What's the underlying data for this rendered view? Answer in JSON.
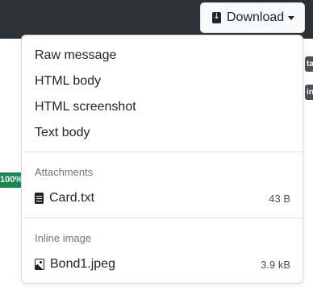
{
  "toolbar": {
    "download_label": "Download"
  },
  "background": {
    "percent_badge": "100%",
    "edge_tab_1": "ta",
    "edge_tab_2": "in"
  },
  "menu": {
    "items": [
      {
        "label": "Raw message"
      },
      {
        "label": "HTML body"
      },
      {
        "label": "HTML screenshot"
      },
      {
        "label": "Text body"
      }
    ],
    "attachments": {
      "header": "Attachments",
      "files": [
        {
          "name": "Card.txt",
          "size": "43 B",
          "icon": "file-text-icon"
        }
      ]
    },
    "inline": {
      "header": "Inline image",
      "files": [
        {
          "name": "Bond1.jpeg",
          "size": "3.9 kB",
          "icon": "file-image-icon"
        }
      ]
    }
  },
  "colors": {
    "topbar": "#2b3136",
    "badge_green": "#198754"
  }
}
